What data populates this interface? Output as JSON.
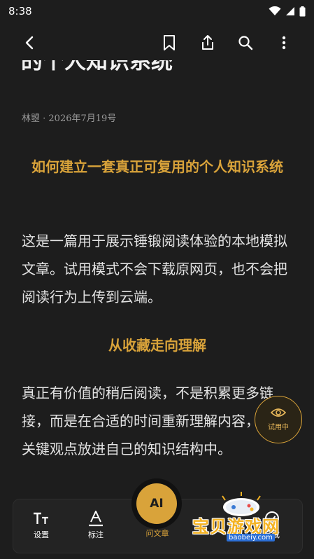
{
  "status_bar": {
    "time": "8:38"
  },
  "article": {
    "title": "的个人知识系统",
    "byline": "林曌 · 2026年7月19号",
    "heading1": "如何建立一套真正可复用的个人知识系统",
    "para1": "这是一篇用于展示锤锻阅读体验的本地模拟文章。试用模式不会下载原网页，也不会把阅读行为上传到云端。",
    "heading2": "从收藏走向理解",
    "para2": "真正有价值的稍后阅读，不是积累更多链接，而是在合适的时间重新理解内容，并把关键观点放进自己的知识结构中。"
  },
  "trial_badge": {
    "label": "试用中",
    "icon": "eye-icon"
  },
  "bottom_bar": {
    "settings_label": "设置",
    "annotate_label": "标注",
    "ai_button": "AI",
    "ai_label": "问文章",
    "last_label": "完成"
  },
  "watermark": {
    "text": "宝贝游戏网",
    "url": "baobeiy.com"
  },
  "colors": {
    "accent": "#d9a33a",
    "background": "#1d1d1d",
    "text": "#e4e4e4"
  }
}
